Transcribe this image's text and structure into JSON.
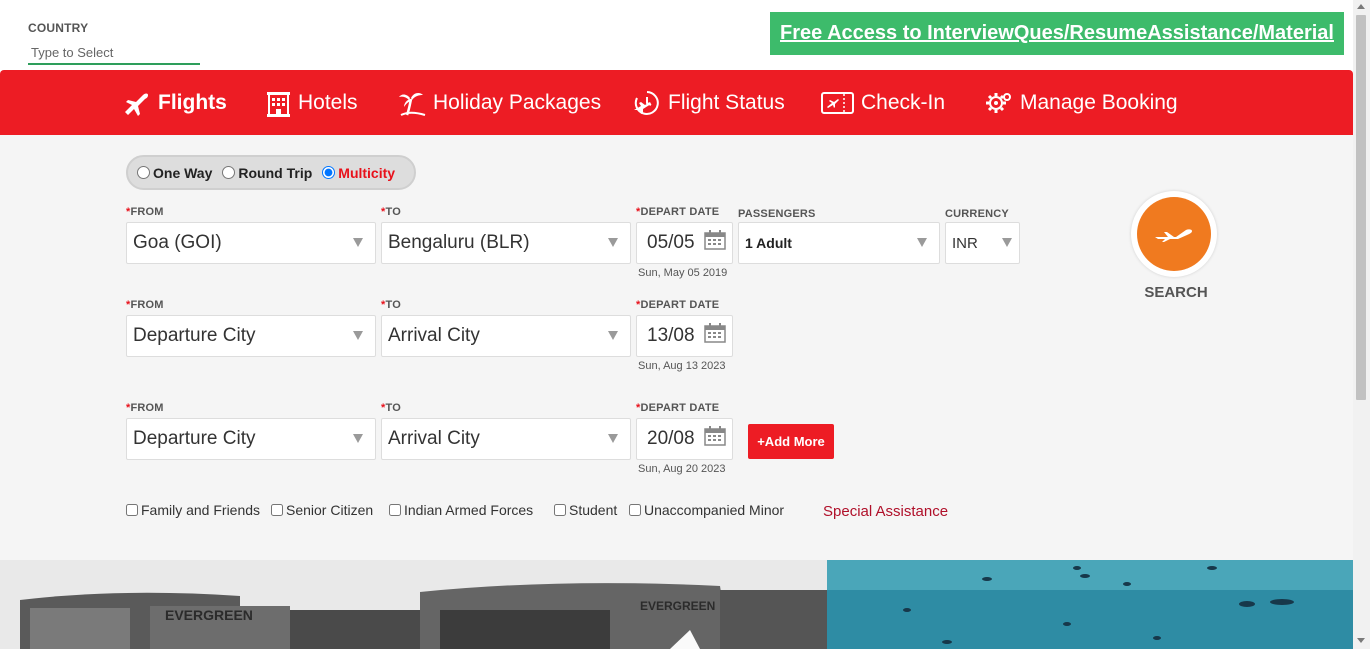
{
  "header": {
    "country_label": "COUNTRY",
    "country_placeholder": "Type to Select",
    "promo_link": "Free Access to InterviewQues/ResumeAssistance/Material"
  },
  "nav": {
    "flights": "Flights",
    "hotels": "Hotels",
    "holiday": "Holiday Packages",
    "status": "Flight Status",
    "checkin": "Check-In",
    "manage": "Manage Booking"
  },
  "trip_type": {
    "one_way": "One Way",
    "round_trip": "Round Trip",
    "multicity": "Multicity",
    "selected": "Multicity"
  },
  "labels": {
    "required_mark": "*",
    "from": "FROM",
    "to": "TO",
    "depart_date": "DEPART DATE",
    "passengers": "PASSENGERS",
    "currency": "CURRENCY"
  },
  "legs": [
    {
      "from": "Goa (GOI)",
      "to": "Bengaluru (BLR)",
      "date": "05/05",
      "date_full": "Sun, May 05 2019"
    },
    {
      "from": "Departure City",
      "to": "Arrival City",
      "date": "13/08",
      "date_full": "Sun, Aug 13 2023"
    },
    {
      "from": "Departure City",
      "to": "Arrival City",
      "date": "20/08",
      "date_full": "Sun, Aug 20 2023"
    }
  ],
  "passengers": "1 Adult",
  "currency": "INR",
  "add_more": "+Add More",
  "search": "SEARCH",
  "options": {
    "family": "Family and Friends",
    "senior": "Senior Citizen",
    "armed": "Indian Armed Forces",
    "student": "Student",
    "minor": "Unaccompanied Minor",
    "special": "Special Assistance"
  },
  "images": {
    "left_sign_1": "EVERGREEN",
    "left_sign_2": "EVERGREEN"
  },
  "colors": {
    "brand_red": "#ed1c24",
    "promo_green": "#3dbb6b",
    "search_orange": "#f07a1f",
    "panel_bg": "#f5f5f5"
  }
}
